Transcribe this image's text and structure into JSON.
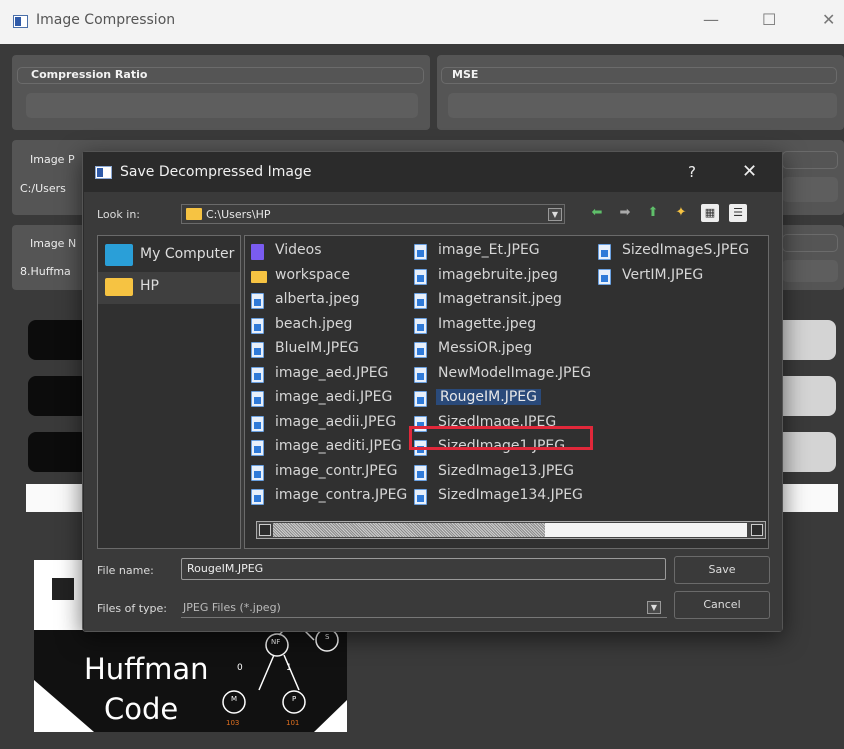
{
  "window": {
    "title": "Image Compression",
    "controls": {
      "minimize": "—",
      "maximize": "☐",
      "close": "✕"
    }
  },
  "panels": {
    "compression_ratio_label": "Compression Ratio",
    "mse_label": "MSE",
    "image_path_label": "Image P",
    "image_path_value": "C:/Users",
    "image_name_label": "Image N",
    "image_name_value": "8.Huffma"
  },
  "preview": {
    "line1": "Huffman",
    "line2": "Code",
    "tree_nodes": [
      "NF",
      "S",
      "M",
      "P"
    ],
    "edge_labels": [
      "0",
      "1"
    ],
    "leaf_codes": [
      "103",
      "101"
    ]
  },
  "dialog": {
    "title": "Save Decompressed Image",
    "help_label": "?",
    "close_label": "✕",
    "look_in_label": "Look in:",
    "look_in_value": "C:\\Users\\HP",
    "sidebar": [
      {
        "label": "My Computer",
        "icon": "computer-icon"
      },
      {
        "label": "HP",
        "icon": "folder-icon"
      }
    ],
    "files": {
      "col1": [
        "Videos",
        "workspace",
        "alberta.jpeg",
        "beach.jpeg",
        "BlueIM.JPEG",
        "image_aed.JPEG",
        "image_aedi.JPEG",
        "image_aedii.JPEG",
        "image_aediti.JPEG",
        "image_contr.JPEG",
        "image_contra.JPEG"
      ],
      "col2": [
        "image_Et.JPEG",
        "imagebruite.jpeg",
        "Imagetransit.jpeg",
        "Imagette.jpeg",
        "MessiOR.jpeg",
        "NewModelImage.JPEG",
        "RougeIM.JPEG",
        "SizedImage.JPEG",
        "SizedImage1.JPEG",
        "SizedImage13.JPEG",
        "SizedImage134.JPEG"
      ],
      "col3": [
        "SizedImageS.JPEG",
        "VertIM.JPEG"
      ]
    },
    "selected_file": "RougeIM.JPEG",
    "file_name_label": "File name:",
    "file_name_value": "RougeIM.JPEG",
    "file_type_label": "Files of type:",
    "file_type_value": "JPEG Files (*.jpeg)",
    "save_button": "Save",
    "cancel_button": "Cancel"
  },
  "colors": {
    "highlight_border": "#e0283a",
    "folder": "#f6c342",
    "nav_green": "#5fbf6a"
  }
}
